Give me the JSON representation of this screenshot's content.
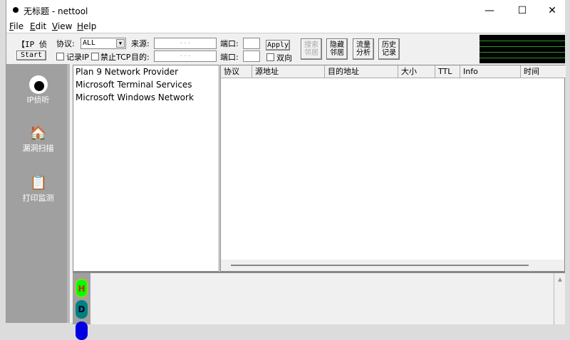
{
  "window": {
    "title": "无标题 - nettool",
    "minimize": "—",
    "maximize": "☐",
    "close": "✕"
  },
  "menu": [
    {
      "label": "File",
      "key": "F",
      "rest": "ile"
    },
    {
      "label": "Edit",
      "key": "E",
      "rest": "dit"
    },
    {
      "label": "View",
      "key": "V",
      "rest": "iew"
    },
    {
      "label": "Help",
      "key": "H",
      "rest": "elp"
    }
  ],
  "toolbar": {
    "ip_label": "【IP 侦",
    "start": "Start",
    "protocol_label": "协议:",
    "protocol_value": "ALL",
    "log_ip": "记录IP",
    "block_tcp": "禁止TCP",
    "source_label": "来源:",
    "source_value": ".   .   .",
    "dest_label": "目的:",
    "dest_value": ".   .   .",
    "port_label": "端口:",
    "port_label2": "端口:",
    "apply": "Apply",
    "bidirectional": "双向",
    "search_neighbors": "搜索邻居",
    "hide_neighbors": "隐藏邻居",
    "traffic_analysis": "流量分析",
    "history": "历史记录"
  },
  "sidebar": [
    {
      "label": "IP侦听",
      "icon": "eye-icon"
    },
    {
      "label": "漏洞扫描",
      "icon": "house-clock-icon"
    },
    {
      "label": "打印监测",
      "icon": "clipboard-icon"
    }
  ],
  "providers": [
    "Plan 9 Network Provider",
    "Microsoft Terminal Services",
    "Microsoft Windows Network"
  ],
  "columns": [
    "协议",
    "源地址",
    "目的地址",
    "大小",
    "TTL",
    "Info",
    "时间"
  ],
  "bottom_buttons": [
    {
      "label": "H",
      "color": "#00ff00"
    },
    {
      "label": "D",
      "color": "#008080"
    }
  ]
}
